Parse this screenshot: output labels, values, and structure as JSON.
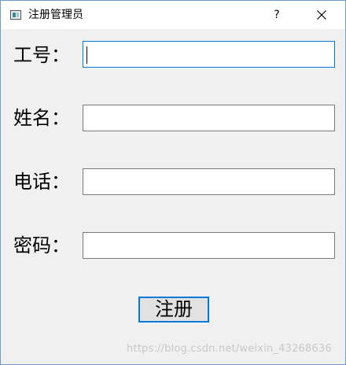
{
  "window": {
    "title": "注册管理员",
    "help_label": "?",
    "close_icon": "close-icon"
  },
  "form": {
    "fields": [
      {
        "label": "工号：",
        "value": "",
        "placeholder": "",
        "focused": true
      },
      {
        "label": "姓名：",
        "value": "",
        "placeholder": ""
      },
      {
        "label": "电话：",
        "value": "",
        "placeholder": ""
      },
      {
        "label": "密码：",
        "value": "",
        "placeholder": ""
      }
    ],
    "submit_label": "注册"
  },
  "watermark": "https://blog.csdn.net/weixin_43268636",
  "colors": {
    "accent": "#0078d7",
    "window_bg": "#f0f0f0",
    "border": "#7a7a7a"
  }
}
